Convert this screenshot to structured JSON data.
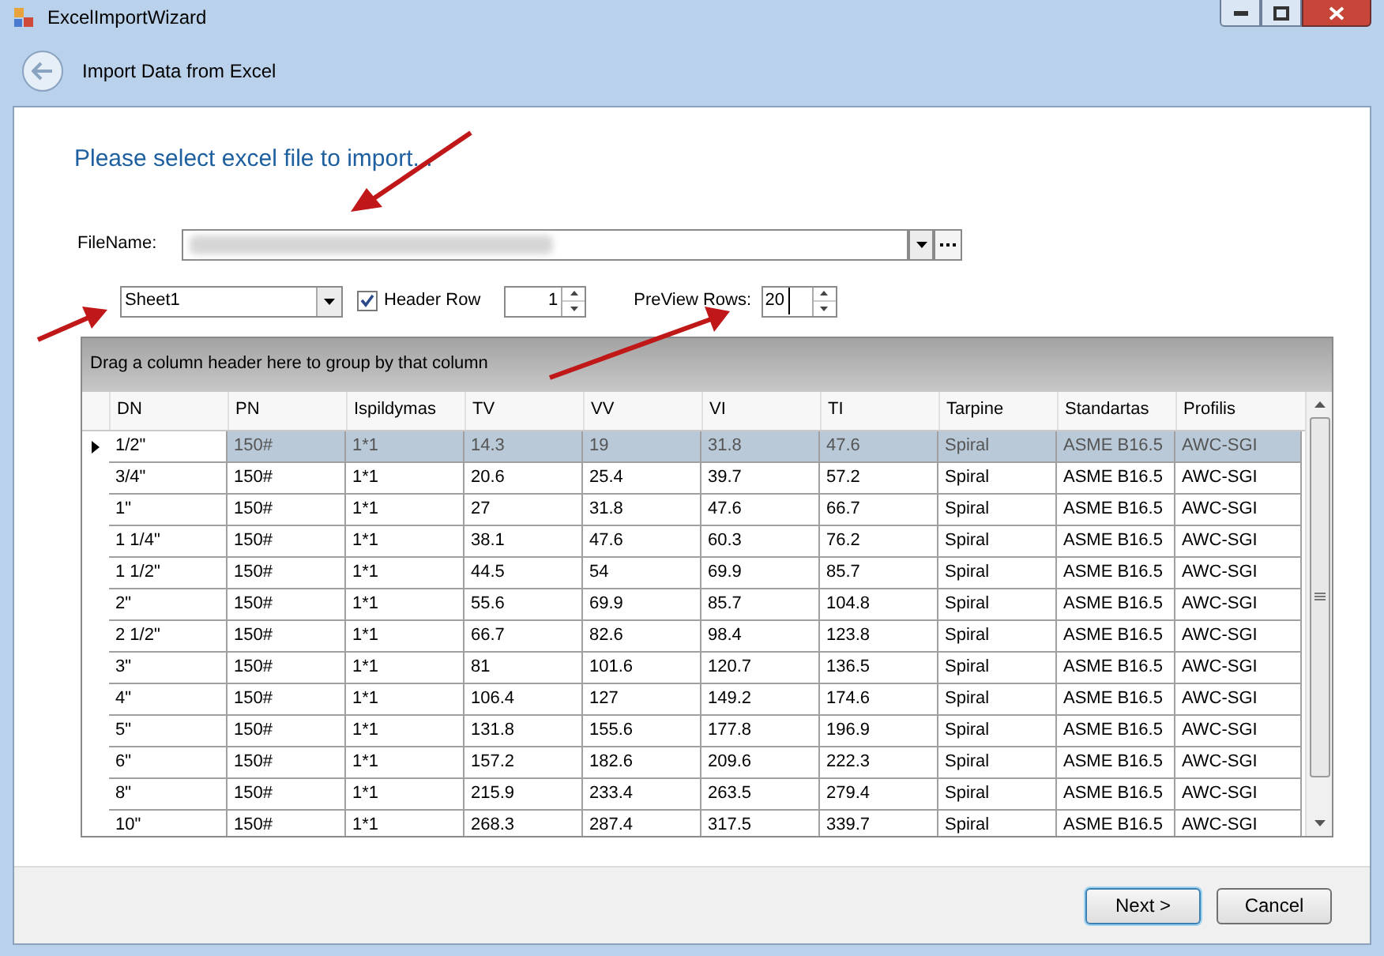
{
  "window": {
    "title": "ExcelImportWizard"
  },
  "header": {
    "title": "Import Data from Excel"
  },
  "heading": "Please select excel file to import...",
  "file": {
    "label": "FileName:"
  },
  "sheet": {
    "value": "Sheet1"
  },
  "header_row": {
    "label": "Header Row",
    "checked": true,
    "value": "1"
  },
  "preview_rows": {
    "label": "PreView Rows:",
    "value": "20"
  },
  "grid": {
    "group_hint": "Drag a column header here to group by that column",
    "columns": [
      "DN",
      "PN",
      "Ispildymas",
      "TV",
      "VV",
      "VI",
      "TI",
      "Tarpine",
      "Standartas",
      "Profilis"
    ],
    "rows": [
      {
        "selected": true,
        "cells": [
          "1/2\"",
          "150#",
          "1*1",
          "14.3",
          "19",
          "31.8",
          "47.6",
          "Spiral",
          "ASME B16.5",
          "AWC-SGI"
        ]
      },
      {
        "selected": false,
        "cells": [
          "3/4\"",
          "150#",
          "1*1",
          "20.6",
          "25.4",
          "39.7",
          "57.2",
          "Spiral",
          "ASME B16.5",
          "AWC-SGI"
        ]
      },
      {
        "selected": false,
        "cells": [
          "1\"",
          "150#",
          "1*1",
          "27",
          "31.8",
          "47.6",
          "66.7",
          "Spiral",
          "ASME B16.5",
          "AWC-SGI"
        ]
      },
      {
        "selected": false,
        "cells": [
          "1 1/4\"",
          "150#",
          "1*1",
          "38.1",
          "47.6",
          "60.3",
          "76.2",
          "Spiral",
          "ASME B16.5",
          "AWC-SGI"
        ]
      },
      {
        "selected": false,
        "cells": [
          "1 1/2\"",
          "150#",
          "1*1",
          "44.5",
          "54",
          "69.9",
          "85.7",
          "Spiral",
          "ASME B16.5",
          "AWC-SGI"
        ]
      },
      {
        "selected": false,
        "cells": [
          "2\"",
          "150#",
          "1*1",
          "55.6",
          "69.9",
          "85.7",
          "104.8",
          "Spiral",
          "ASME B16.5",
          "AWC-SGI"
        ]
      },
      {
        "selected": false,
        "cells": [
          "2 1/2\"",
          "150#",
          "1*1",
          "66.7",
          "82.6",
          "98.4",
          "123.8",
          "Spiral",
          "ASME B16.5",
          "AWC-SGI"
        ]
      },
      {
        "selected": false,
        "cells": [
          "3\"",
          "150#",
          "1*1",
          "81",
          "101.6",
          "120.7",
          "136.5",
          "Spiral",
          "ASME B16.5",
          "AWC-SGI"
        ]
      },
      {
        "selected": false,
        "cells": [
          "4\"",
          "150#",
          "1*1",
          "106.4",
          "127",
          "149.2",
          "174.6",
          "Spiral",
          "ASME B16.5",
          "AWC-SGI"
        ]
      },
      {
        "selected": false,
        "cells": [
          "5\"",
          "150#",
          "1*1",
          "131.8",
          "155.6",
          "177.8",
          "196.9",
          "Spiral",
          "ASME B16.5",
          "AWC-SGI"
        ]
      },
      {
        "selected": false,
        "cells": [
          "6\"",
          "150#",
          "1*1",
          "157.2",
          "182.6",
          "209.6",
          "222.3",
          "Spiral",
          "ASME B16.5",
          "AWC-SGI"
        ]
      },
      {
        "selected": false,
        "cells": [
          "8\"",
          "150#",
          "1*1",
          "215.9",
          "233.4",
          "263.5",
          "279.4",
          "Spiral",
          "ASME B16.5",
          "AWC-SGI"
        ]
      },
      {
        "selected": false,
        "cells": [
          "10\"",
          "150#",
          "1*1",
          "268.3",
          "287.4",
          "317.5",
          "339.7",
          "Spiral",
          "ASME B16.5",
          "AWC-SGI"
        ]
      }
    ]
  },
  "buttons": [
    "Next >",
    "Cancel"
  ]
}
